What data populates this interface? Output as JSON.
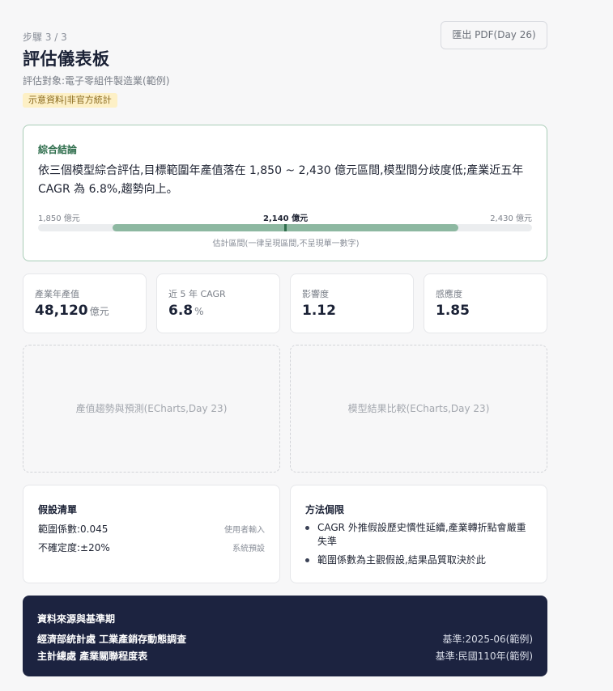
{
  "header": {
    "step": "步驟 3 / 3",
    "title": "評估儀表板",
    "subject": "評估對象:電子零組件製造業(範例)",
    "demo_badge": "示意資料|非官方統計",
    "export_label": "匯出 PDF(Day 26)"
  },
  "conclusion": {
    "label": "綜合結論",
    "text": "依三個模型綜合評估,目標範圍年產值落在 1,850 ~ 2,430 億元區間,模型間分歧度低;產業近五年 CAGR 為 6.8%,趨勢向上。",
    "range": {
      "min_label": "1,850 億元",
      "mid_label": "2,140 億元",
      "max_label": "2,430 億元",
      "fill_start_fraction": 0.15,
      "fill_end_fraction": 0.85,
      "marker_fraction": 0.5
    },
    "note": "估計區間(一律呈現區間,不呈現單一數字)"
  },
  "metrics": [
    {
      "label": "產業年產值",
      "value": "48,120",
      "unit": "億元"
    },
    {
      "label": "近 5 年 CAGR",
      "value": "6.8",
      "unit": "%"
    },
    {
      "label": "影響度",
      "value": "1.12",
      "unit": ""
    },
    {
      "label": "感應度",
      "value": "1.85",
      "unit": ""
    }
  ],
  "charts": {
    "trend_placeholder": "產值趨勢與預測(ECharts,Day 23)",
    "model_placeholder": "模型結果比較(ECharts,Day 23)"
  },
  "assumptions": {
    "title": "假設清單",
    "items": [
      {
        "text": "範圍係數:0.045",
        "source": "使用者輸入"
      },
      {
        "text": "不確定度:±20%",
        "source": "系統預設"
      }
    ]
  },
  "method_limits": {
    "title": "方法侷限",
    "items": [
      "CAGR 外推假設歷史慣性延續,產業轉折點會嚴重失準",
      "範圍係數為主觀假設,結果品質取決於此"
    ]
  },
  "sources": {
    "title": "資料來源與基準期",
    "rows": [
      {
        "name": "經濟部統計處 工業產銷存動態調查",
        "base": "基準:2025-06(範例)"
      },
      {
        "name": "主計總處 產業關聯程度表",
        "base": "基準:民國110年(範例)"
      }
    ]
  }
}
